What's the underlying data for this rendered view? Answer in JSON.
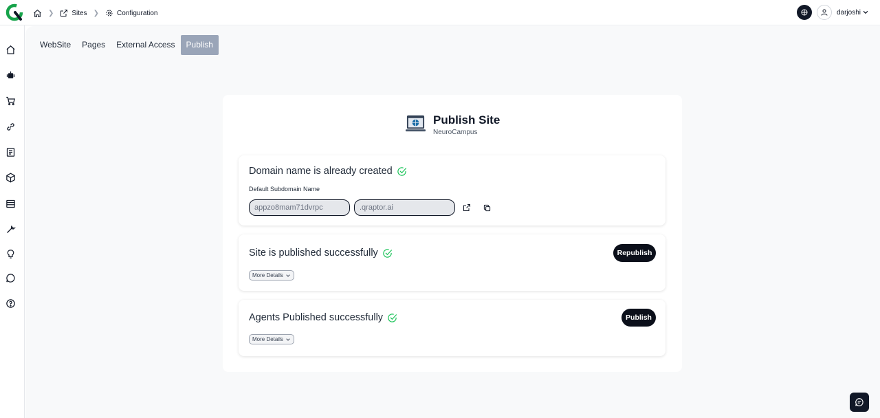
{
  "breadcrumbs": {
    "home": "Home",
    "sites": "Sites",
    "configuration": "Configuration"
  },
  "user": {
    "name": "darjoshi"
  },
  "sidebar": {
    "items": [
      {
        "icon": "home-icon"
      },
      {
        "icon": "robot-icon"
      },
      {
        "icon": "cart-icon"
      },
      {
        "icon": "link-icon"
      },
      {
        "icon": "book-icon"
      },
      {
        "icon": "cube-icon"
      },
      {
        "icon": "list-icon"
      },
      {
        "icon": "wrench-icon"
      },
      {
        "icon": "bulb-icon"
      },
      {
        "icon": "chat-icon"
      },
      {
        "icon": "help-icon"
      }
    ]
  },
  "tabs": [
    {
      "label": "WebSite",
      "active": false
    },
    {
      "label": "Pages",
      "active": false
    },
    {
      "label": "External Access",
      "active": false
    },
    {
      "label": "Publish",
      "active": true
    }
  ],
  "card": {
    "title": "Publish Site",
    "subtitle": "NeuroCampus"
  },
  "domain": {
    "title": "Domain name is already created",
    "label": "Default Subdomain Name",
    "subdomain_value": "appzo8mam71dvrpc",
    "suffix_value": ".qraptor.ai"
  },
  "site": {
    "title": "Site is published successfully",
    "more_label": "More Details",
    "button_label": "Republish"
  },
  "agents": {
    "title": "Agents Published successfully",
    "more_label": "More Details",
    "button_label": "Publish"
  },
  "colors": {
    "accent_green": "#22c55e",
    "active_tab": "#9aa5b8",
    "dark": "#0b0f1a"
  }
}
